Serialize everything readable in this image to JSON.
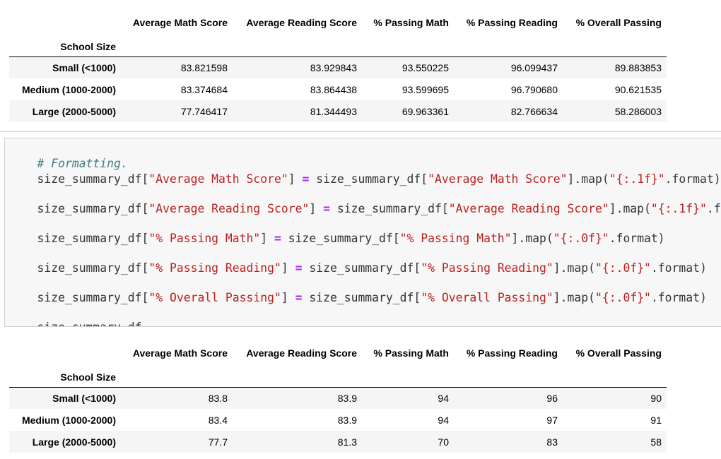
{
  "table_before": {
    "columns": [
      "Average Math Score",
      "Average Reading Score",
      "% Passing Math",
      "% Passing Reading",
      "% Overall Passing"
    ],
    "index_name": "School Size",
    "rows": [
      {
        "label": "Small (<1000)",
        "values": [
          "83.821598",
          "83.929843",
          "93.550225",
          "96.099437",
          "89.883853"
        ]
      },
      {
        "label": "Medium (1000-2000)",
        "values": [
          "83.374684",
          "83.864438",
          "93.599695",
          "96.790680",
          "90.621535"
        ]
      },
      {
        "label": "Large (2000-5000)",
        "values": [
          "77.746417",
          "81.344493",
          "69.963361",
          "82.766634",
          "58.286003"
        ]
      }
    ]
  },
  "code_cell": {
    "comment": "# Formatting.",
    "lines": [
      {
        "var": "size_summary_df[",
        "key": "\"Average Math Score\"",
        "mid": "] ",
        "op": "=",
        "rhs": " size_summary_df[",
        "key2": "\"Average Math Score\"",
        "map": "].map(",
        "fmt": "\"{:.1f}\"",
        "end": ".format)"
      },
      {
        "var": "size_summary_df[",
        "key": "\"Average Reading Score\"",
        "mid": "] ",
        "op": "=",
        "rhs": " size_summary_df[",
        "key2": "\"Average Reading Score\"",
        "map": "].map(",
        "fmt": "\"{:.1f}\"",
        "end": ".format)"
      },
      {
        "var": "size_summary_df[",
        "key": "\"% Passing Math\"",
        "mid": "] ",
        "op": "=",
        "rhs": " size_summary_df[",
        "key2": "\"% Passing Math\"",
        "map": "].map(",
        "fmt": "\"{:.0f}\"",
        "end": ".format)"
      },
      {
        "var": "size_summary_df[",
        "key": "\"% Passing Reading\"",
        "mid": "] ",
        "op": "=",
        "rhs": " size_summary_df[",
        "key2": "\"% Passing Reading\"",
        "map": "].map(",
        "fmt": "\"{:.0f}\"",
        "end": ".format)"
      },
      {
        "var": "size_summary_df[",
        "key": "\"% Overall Passing\"",
        "mid": "] ",
        "op": "=",
        "rhs": " size_summary_df[",
        "key2": "\"% Overall Passing\"",
        "map": "].map(",
        "fmt": "\"{:.0f}\"",
        "end": ".format)"
      }
    ],
    "last_line": "size_summary_df"
  },
  "table_after": {
    "columns": [
      "Average Math Score",
      "Average Reading Score",
      "% Passing Math",
      "% Passing Reading",
      "% Overall Passing"
    ],
    "index_name": "School Size",
    "rows": [
      {
        "label": "Small (<1000)",
        "values": [
          "83.8",
          "83.9",
          "94",
          "96",
          "90"
        ]
      },
      {
        "label": "Medium (1000-2000)",
        "values": [
          "83.4",
          "83.9",
          "94",
          "97",
          "91"
        ]
      },
      {
        "label": "Large (2000-5000)",
        "values": [
          "77.7",
          "81.3",
          "70",
          "83",
          "58"
        ]
      }
    ]
  },
  "colors": {
    "comment": "#408080",
    "string": "#ba2121",
    "operator": "#aa22ff",
    "code_background": "#f7f7f7",
    "row_stripe": "#f5f5f5"
  }
}
